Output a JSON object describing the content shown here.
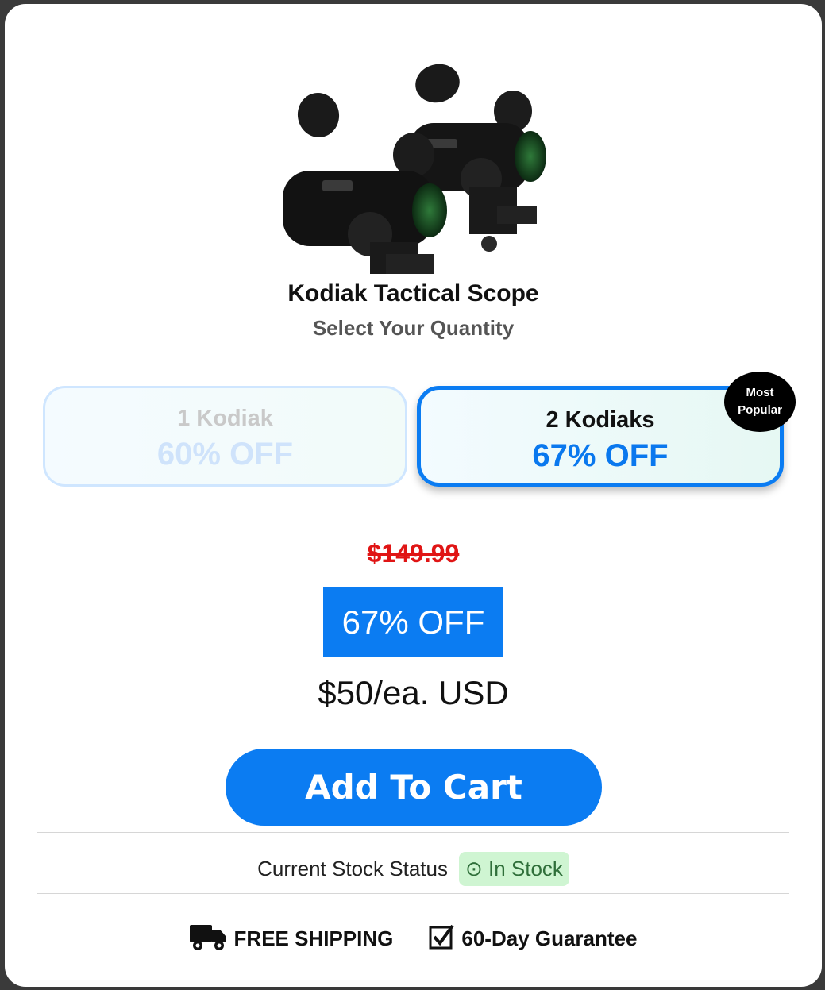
{
  "product": {
    "title": "Kodiak Tactical Scope",
    "subtitle": "Select Your Quantity",
    "image_icon": "twin-red-dot-scope-image"
  },
  "quantity_options": [
    {
      "name": "1 Kodiak",
      "discount": "60% OFF",
      "selected": false
    },
    {
      "name": "2 Kodiaks",
      "discount": "67% OFF",
      "selected": true
    }
  ],
  "badge": {
    "line1": "Most",
    "line2": "Popular"
  },
  "pricing": {
    "original_price": "$149.99",
    "discount_label": "67% OFF",
    "unit_price": "$50/ea. USD"
  },
  "cart": {
    "button_label": "Add To Cart"
  },
  "stock": {
    "label": "Current Stock Status",
    "status": "⊙ In Stock"
  },
  "perks": [
    {
      "icon": "truck-icon",
      "label": "FREE SHIPPING"
    },
    {
      "icon": "checkbox-icon",
      "label": "60-Day Guarantee"
    }
  ],
  "colors": {
    "accent": "#0b7cf2",
    "strike_price": "#e01515",
    "badge_bg": "#000000",
    "stock_bg": "#cff5d2"
  }
}
